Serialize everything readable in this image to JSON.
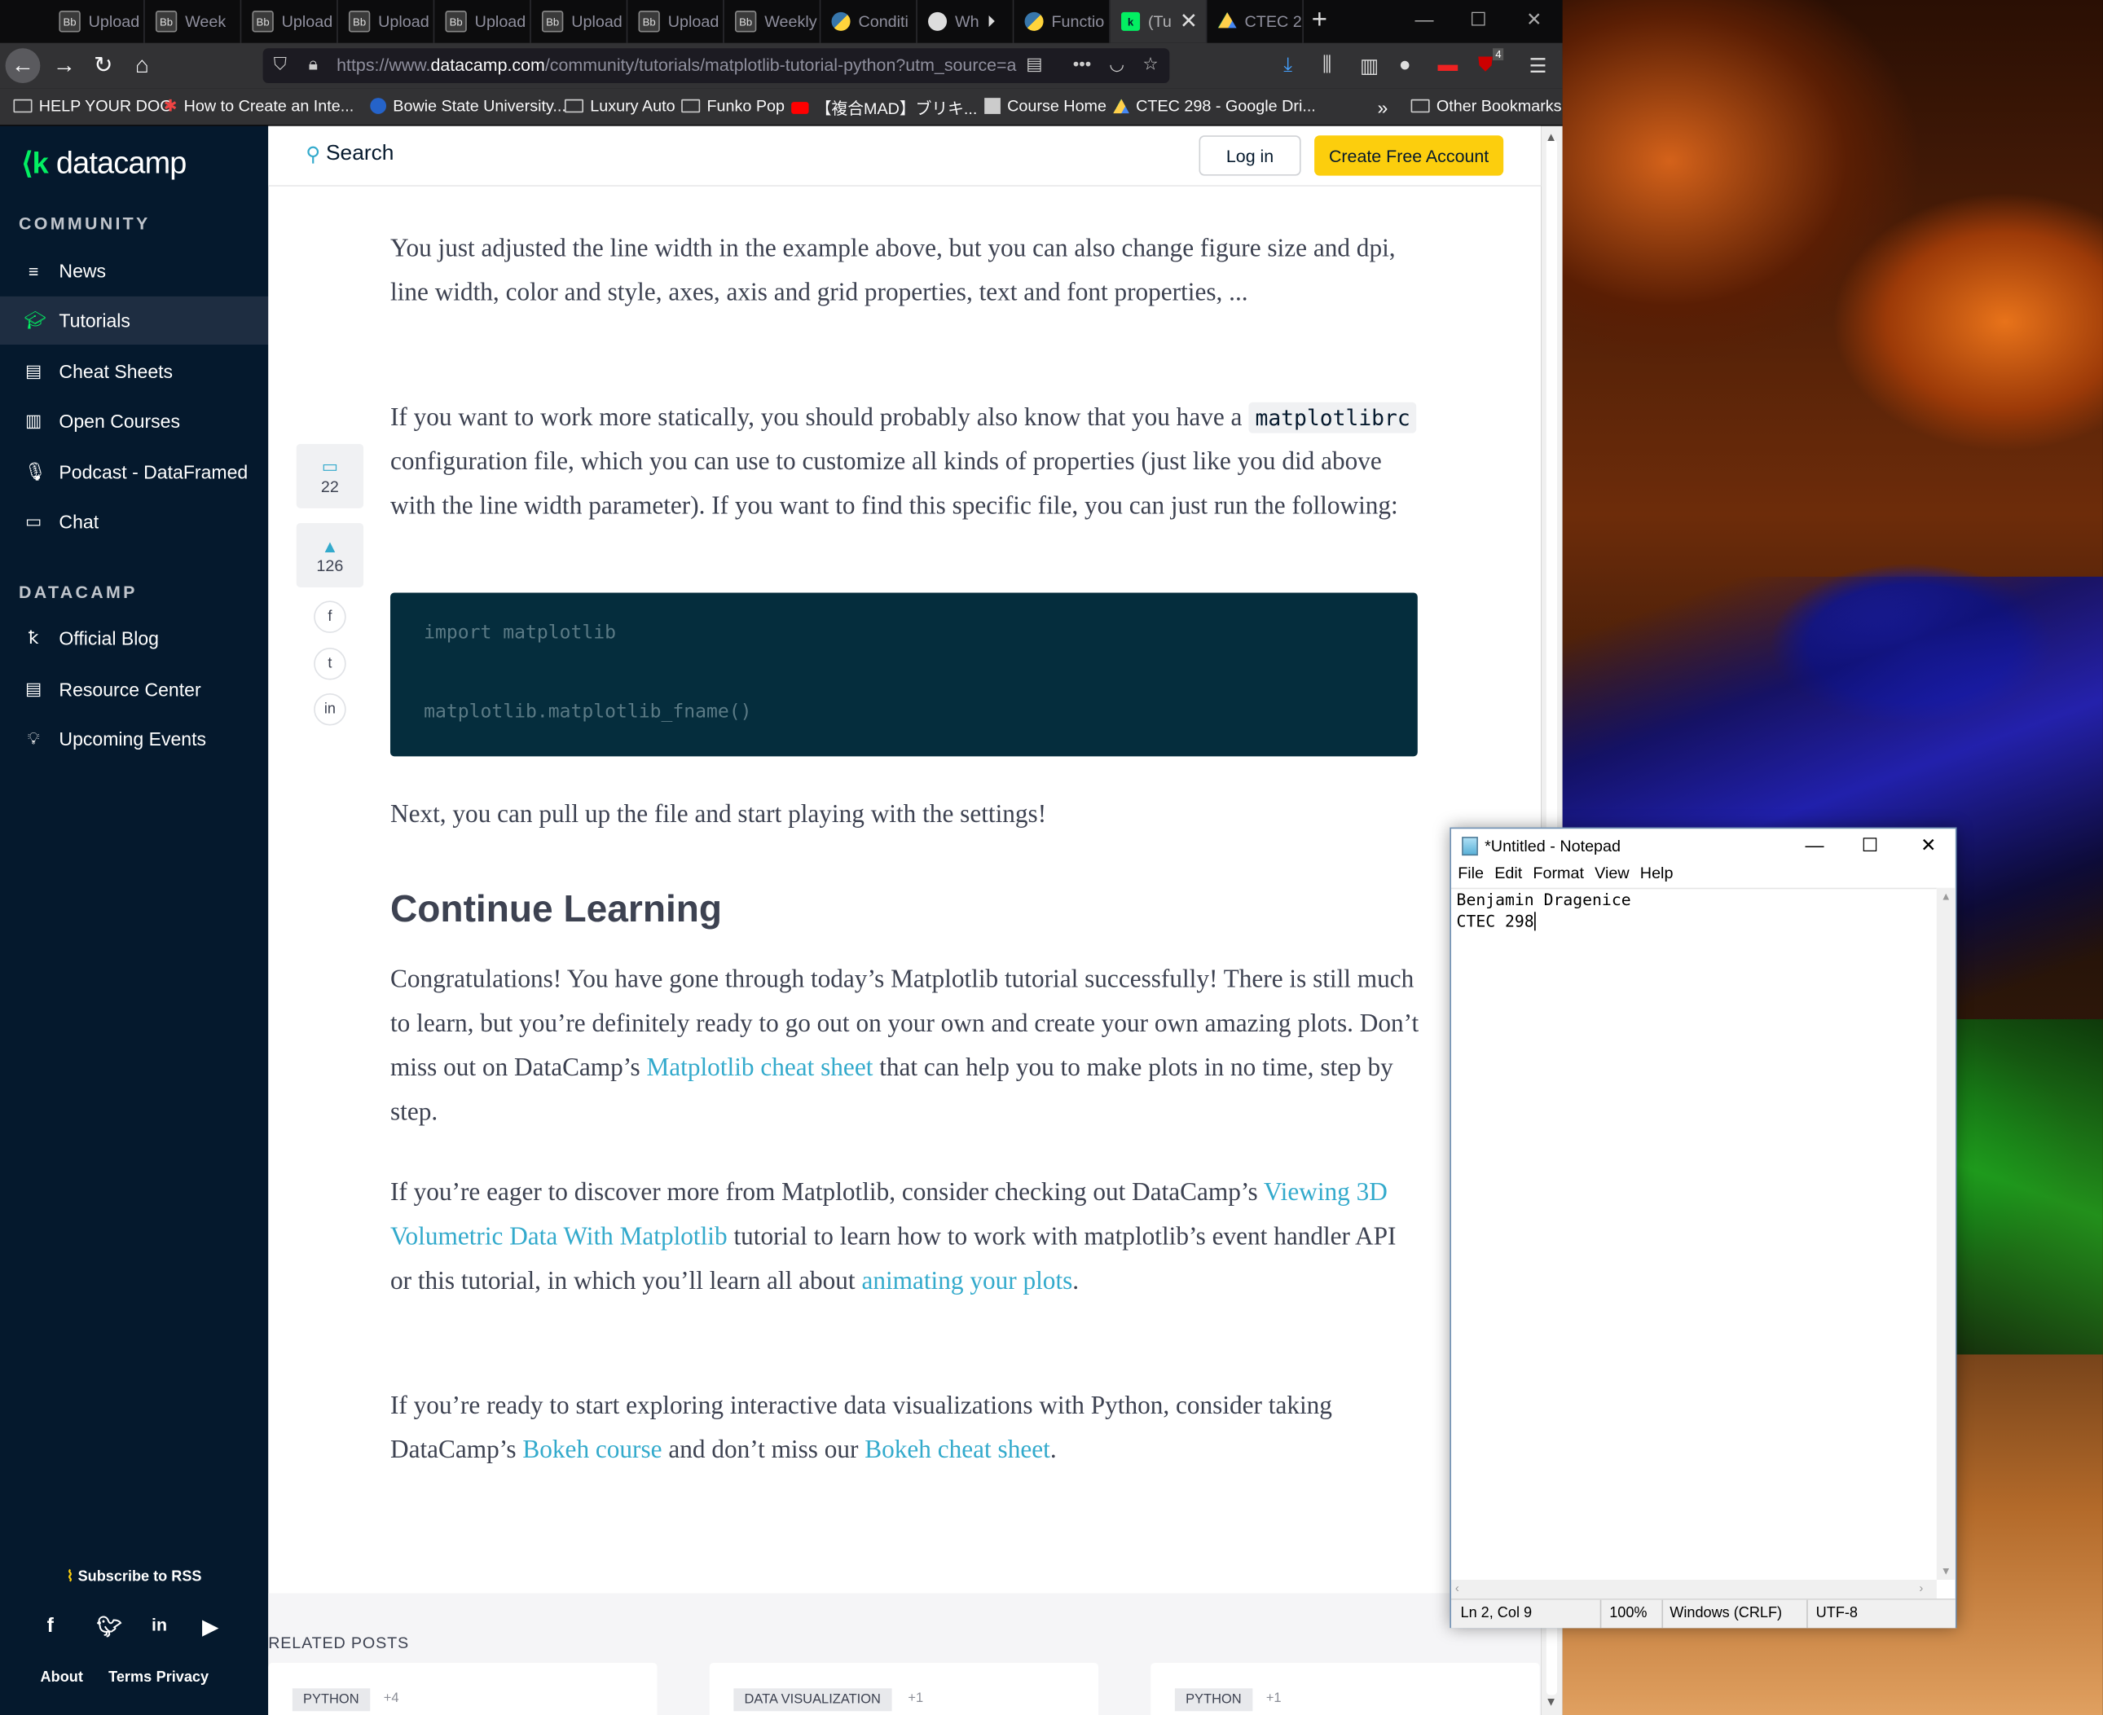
{
  "browser": {
    "tabs": [
      {
        "label": "Upload",
        "icon": "blackboard-icon"
      },
      {
        "label": "Week",
        "icon": "blackboard-icon"
      },
      {
        "label": "Upload",
        "icon": "blackboard-icon"
      },
      {
        "label": "Upload",
        "icon": "blackboard-icon"
      },
      {
        "label": "Upload",
        "icon": "blackboard-icon"
      },
      {
        "label": "Upload",
        "icon": "blackboard-icon"
      },
      {
        "label": "Upload",
        "icon": "blackboard-icon"
      },
      {
        "label": "Weekly",
        "icon": "blackboard-icon"
      },
      {
        "label": "Conditi",
        "icon": "python-icon"
      },
      {
        "label": "Wh",
        "icon": "github-icon"
      },
      {
        "label": "Functio",
        "icon": "python-icon"
      },
      {
        "label": "(Tu",
        "icon": "datacamp-icon"
      },
      {
        "label": "CTEC 2",
        "icon": "google-drive-icon"
      }
    ],
    "url_prefix": "https://www.",
    "url_domain": "datacamp.com",
    "url_rest": "/community/tutorials/matplotlib-tutorial-python?utm_source=a",
    "badge_count": "4",
    "bookmarks": [
      "HELP YOUR DOG",
      "How to Create an Inte...",
      "Bowie State University...",
      "Luxury Auto",
      "Funko Pop",
      "【複合MAD】ブリキ...",
      "Course Home",
      "CTEC 298 - Google Dri...",
      "Other Bookmarks"
    ]
  },
  "sidebar": {
    "logo": "datacamp",
    "section1": "COMMUNITY",
    "items1": [
      {
        "label": "News",
        "icon": "list-icon"
      },
      {
        "label": "Tutorials",
        "icon": "graduation-cap-icon"
      },
      {
        "label": "Cheat Sheets",
        "icon": "document-icon"
      },
      {
        "label": "Open Courses",
        "icon": "book-icon"
      },
      {
        "label": "Podcast - DataFramed",
        "icon": "microphone-icon"
      },
      {
        "label": "Chat",
        "icon": "chat-icon"
      }
    ],
    "section2": "DATACAMP",
    "items2": [
      {
        "label": "Official Blog",
        "icon": "datacamp-mark-icon"
      },
      {
        "label": "Resource Center",
        "icon": "document-icon"
      },
      {
        "label": "Upcoming Events",
        "icon": "lightbulb-icon"
      }
    ],
    "rss": "Subscribe to RSS",
    "footer_links": [
      "About",
      "Terms",
      "Privacy"
    ]
  },
  "header": {
    "search": "Search",
    "login": "Log in",
    "create": "Create Free Account"
  },
  "article": {
    "p1": "You just adjusted the line width in the example above, but you can also change figure size and dpi, line width, color and style, axes, axis and grid properties, text and font properties, ...",
    "p2_before": "If you want to work more statically, you should probably also know that you have a ",
    "p2_code": "matplotlibrc",
    "p2_after": " configuration file, which you can use to customize all kinds of properties (just like you did above with the line width parameter). If you want to find this specific file, you can just run the following:",
    "code_line1": "import matplotlib",
    "code_line2": "matplotlib.matplotlib_fname()",
    "p3": "Next, you can pull up the file and start playing with the settings!",
    "heading": "Continue Learning",
    "p4_a": "Congratulations! You have gone through today’s Matplotlib tutorial successfully! There is still much to learn, but you’re definitely ready to go out on your own and create your own amazing plots. Don’t miss out on DataCamp’s ",
    "p4_link": "Matplotlib cheat sheet",
    "p4_b": " that can help you to make plots in no time, step by step.",
    "p5_a": "If you’re eager to discover more from Matplotlib, consider checking out DataCamp’s ",
    "p5_link1": "Viewing 3D Volumetric Data With Matplotlib",
    "p5_b": " tutorial to learn how to work with matplotlib’s event handler API or this tutorial, in which you’ll learn all about ",
    "p5_link2": "animating your plots",
    "p5_c": ".",
    "p6_a": "If you’re ready to start exploring interactive data visualizations with Python, consider taking DataCamp’s ",
    "p6_link1": "Bokeh course",
    "p6_b": " and don’t miss our ",
    "p6_link2": "Bokeh cheat sheet",
    "p6_c": "."
  },
  "share": {
    "comments": "22",
    "upvotes": "126"
  },
  "related": {
    "title": "RELATED POSTS",
    "cards": [
      {
        "tag": "PYTHON",
        "extra": "+4"
      },
      {
        "tag": "DATA VISUALIZATION",
        "extra": "+1"
      },
      {
        "tag": "PYTHON",
        "extra": "+1"
      }
    ]
  },
  "notepad": {
    "title": "*Untitled - Notepad",
    "menu": [
      "File",
      "Edit",
      "Format",
      "View",
      "Help"
    ],
    "line1": "Benjamin Dragenice",
    "line2": "CTEC 298",
    "status_pos": "Ln 2, Col 9",
    "status_zoom": "100%",
    "status_eol": "Windows (CRLF)",
    "status_enc": "UTF-8"
  }
}
